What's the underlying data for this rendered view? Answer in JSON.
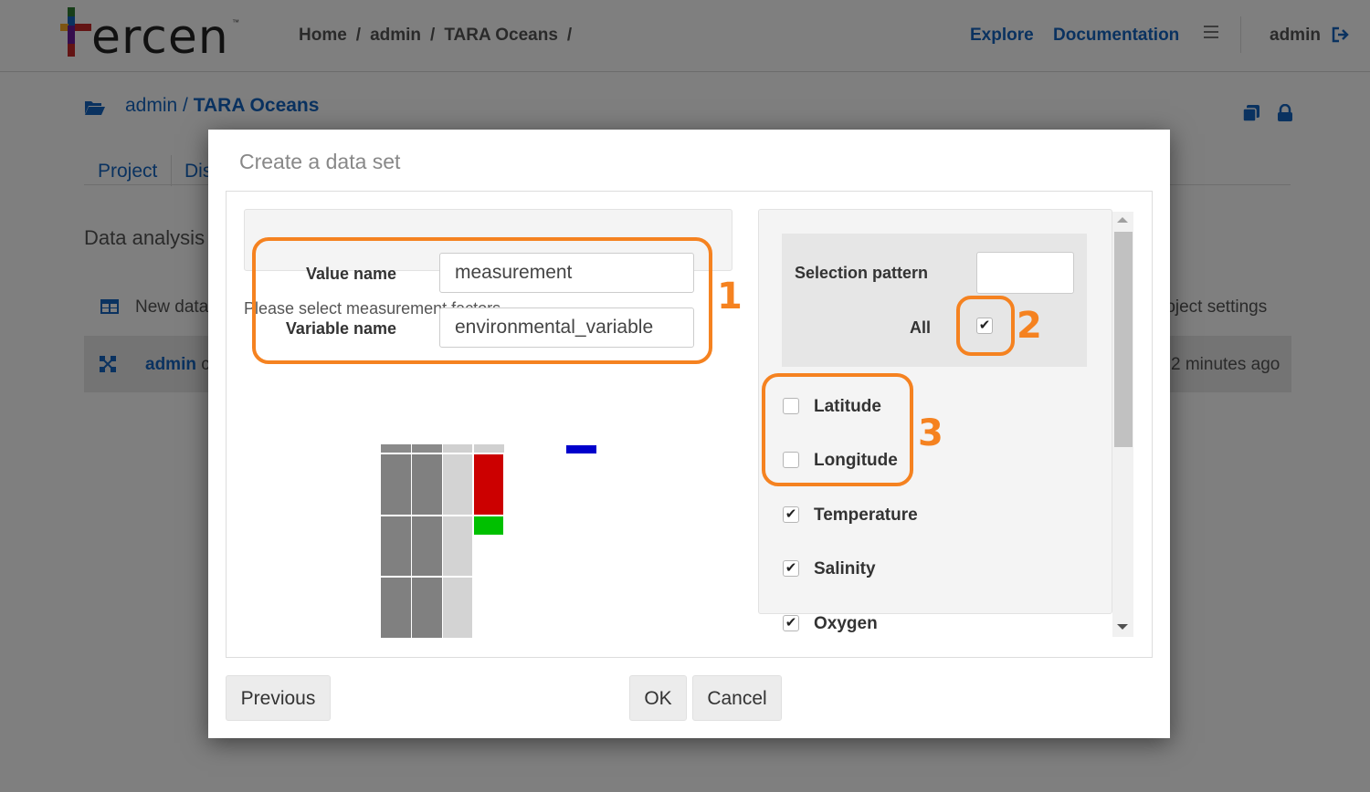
{
  "app": {
    "logo_text": "ercen",
    "logo_tm": "™",
    "breadcrumb": [
      "Home",
      "admin",
      "TARA Oceans"
    ],
    "breadcrumb_sep": "/",
    "nav": {
      "explore": "Explore",
      "documentation": "Documentation"
    },
    "user": "admin"
  },
  "project": {
    "owner": "admin",
    "sep": "/",
    "name": "TARA Oceans",
    "tabs": [
      "Project",
      "Dis"
    ],
    "section_title": "Data analysis",
    "new_data_label": "New data",
    "project_settings_label": "roject settings",
    "row": {
      "name": "admin",
      "suffix": "c",
      "time": "2 minutes ago"
    }
  },
  "dialog": {
    "title": "Create a data set",
    "value_name_label": "Value name",
    "value_name": "measurement",
    "measurement_hint": "Please select measurement factors",
    "variable_name_label": "Variable name",
    "variable_name": "environmental_variable",
    "selection_pattern_label": "Selection pattern",
    "selection_pattern_value": "",
    "all_label": "All",
    "all_checked": true,
    "factors": [
      {
        "label": "Latitude",
        "checked": false
      },
      {
        "label": "Longitude",
        "checked": false
      },
      {
        "label": "Temperature",
        "checked": true
      },
      {
        "label": "Salinity",
        "checked": true
      },
      {
        "label": "Oxygen",
        "checked": true
      }
    ],
    "buttons": {
      "previous": "Previous",
      "ok": "OK",
      "cancel": "Cancel"
    }
  },
  "annotations": [
    "1",
    "2",
    "3"
  ],
  "colors": {
    "accent": "#f58220",
    "link": "#1565c0",
    "preview_value": "#cc0000",
    "preview_variable": "#00c000",
    "preview_marker": "#0000cc",
    "preview_dark": "#808080",
    "preview_light": "#d3d3d3"
  }
}
